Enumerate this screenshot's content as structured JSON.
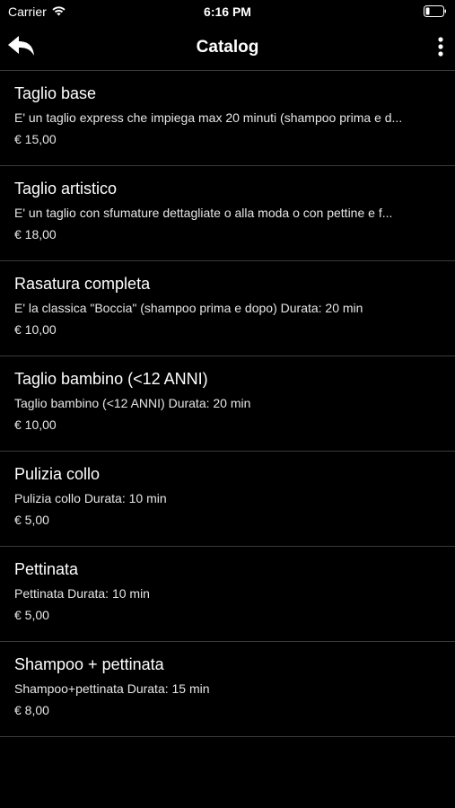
{
  "status_bar": {
    "carrier": "Carrier",
    "time": "6:16 PM",
    "icons": [
      "wifi-icon",
      "battery-icon"
    ]
  },
  "nav": {
    "title": "Catalog",
    "back_icon": "back-arrow-icon",
    "more_icon": "more-vertical-icon"
  },
  "items": [
    {
      "title": "Taglio base",
      "description": "E' un taglio express che impiega max 20 minuti (shampoo prima e d...",
      "price": "€ 15,00"
    },
    {
      "title": "Taglio artistico",
      "description": "E' un taglio con sfumature dettagliate o alla moda o con pettine e f...",
      "price": "€ 18,00"
    },
    {
      "title": "Rasatura completa",
      "description": "E' la classica \"Boccia\" (shampoo prima e dopo) Durata: 20 min",
      "price": "€ 10,00"
    },
    {
      "title": "Taglio bambino (<12 ANNI)",
      "description": "Taglio bambino (<12 ANNI) Durata: 20 min",
      "price": "€ 10,00"
    },
    {
      "title": "Pulizia collo",
      "description": "Pulizia collo Durata: 10 min",
      "price": "€ 5,00"
    },
    {
      "title": "Pettinata",
      "description": "Pettinata Durata: 10 min",
      "price": "€ 5,00"
    },
    {
      "title": "Shampoo + pettinata",
      "description": "Shampoo+pettinata Durata: 15 min",
      "price": "€ 8,00"
    }
  ],
  "colors": {
    "background": "#000000",
    "text": "#ffffff",
    "divider": "#3a3a3a"
  }
}
